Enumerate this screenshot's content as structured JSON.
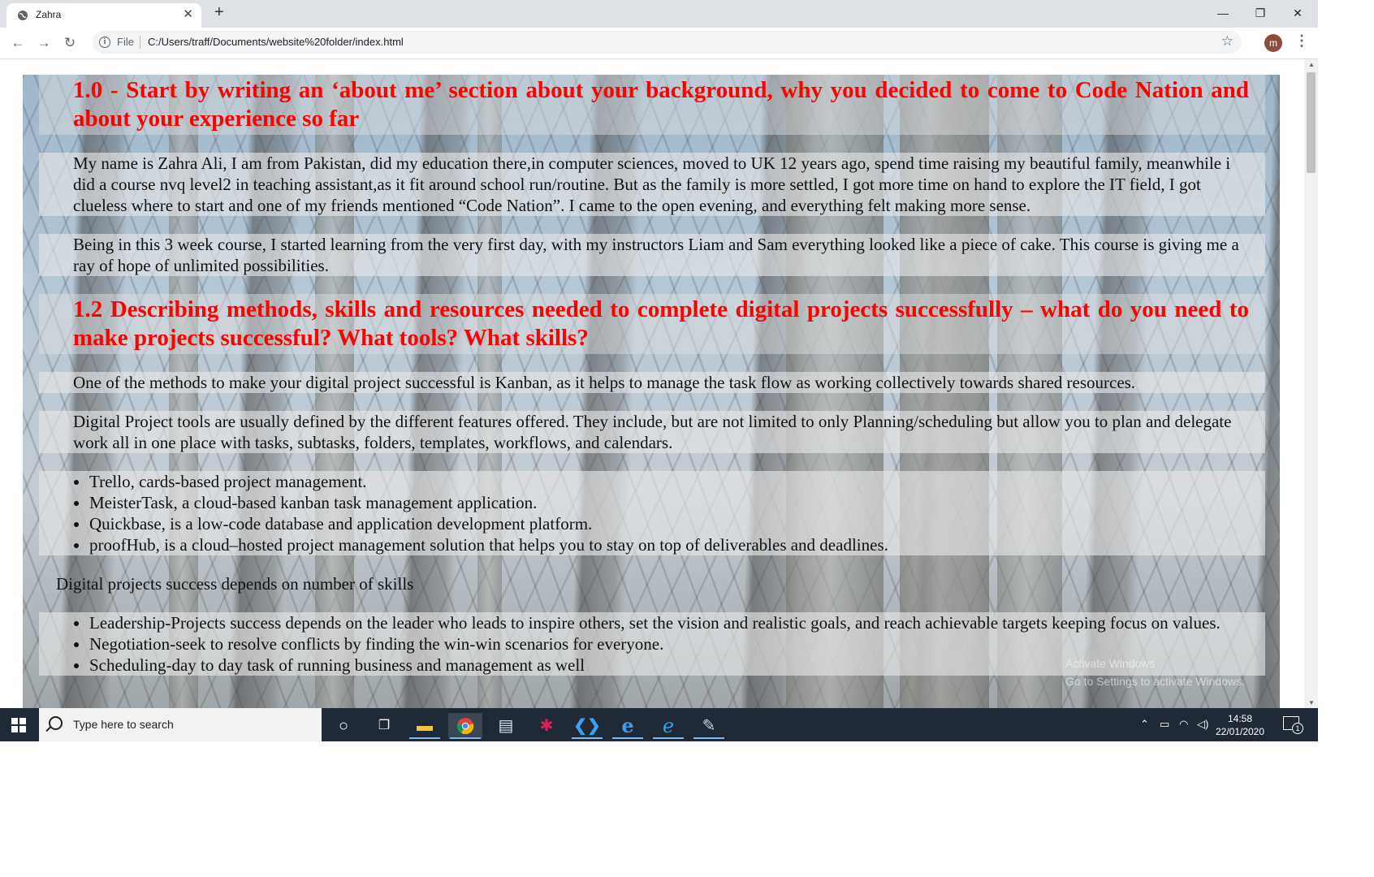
{
  "browser": {
    "tab_title": "Zahra",
    "tab_close": "✕",
    "new_tab": "+",
    "window_minimize": "—",
    "window_restore": "❐",
    "window_close": "✕",
    "scheme_label": "File",
    "url": "C:/Users/traff/Documents/website%20folder/index.html",
    "profile_initial": "m"
  },
  "page": {
    "heading1": "1.0 - Start by writing an ‘about me’ section about your background, why you decided to come to Code Nation and about your experience so far",
    "para1": "My name is Zahra Ali, I am from Pakistan, did my education there,in computer sciences, moved to UK 12 years ago, spend time raising my beautiful family, meanwhile i did a course nvq level2 in teaching assistant,as it fit around school run/routine. But as the family is more settled, I got more time on hand to explore the IT field, I got clueless where to start and one of my friends mentioned “Code Nation”. I came to the open evening, and everything felt making more sense.",
    "para2": "Being in this 3 week course, I started learning from the very first day, with my instructors Liam and Sam everything looked like a piece of cake. This course is giving me a ray of hope of unlimited possibilities.",
    "heading2": "1.2 Describing methods, skills and resources needed to complete digital projects successfully – what do you need to make projects successful? What tools? What skills?",
    "para3": "One of the methods to make your digital project successful is Kanban, as it helps to manage the task flow as working collectively towards shared resources.",
    "para4": "Digital Project tools are usually defined by the different features offered. They include, but are not limited to only Planning/scheduling but allow you to plan and delegate work all in one place with tasks, subtasks, folders, templates, workflows, and calendars.",
    "tools": [
      "Trello, cards-based project management.",
      "MeisterTask, a cloud-based kanban task management application.",
      "Quickbase, is a low-code database and application development platform.",
      "proofHub, is a cloud–hosted project management solution that helps you to stay on top of deliverables and deadlines."
    ],
    "skills_intro": "Digital projects success depends on number of skills",
    "skills": [
      "Leadership-Projects success depends on the leader who leads to inspire others, set the vision and realistic goals, and reach achievable targets keeping focus on values.",
      "Negotiation-seek to resolve conflicts by finding the win-win scenarios for everyone.",
      "Scheduling-day to day task of running business and management as well"
    ]
  },
  "watermark": {
    "line1": "Activate Windows",
    "line2": "Go to Settings to activate Windows."
  },
  "taskbar": {
    "search_placeholder": "Type here to search",
    "time": "14:58",
    "date": "22/01/2020",
    "notification_count": "1"
  },
  "icons": [
    "globe-icon",
    "back-arrow-icon",
    "forward-arrow-icon",
    "reload-icon",
    "info-icon",
    "star-icon",
    "windows-start-icon",
    "search-icon",
    "cortana-icon",
    "task-view-icon",
    "file-explorer-icon",
    "chrome-icon",
    "notepad-icon",
    "slack-icon",
    "vscode-icon",
    "edge-icon",
    "ie-icon",
    "paint-icon",
    "chevron-up-icon",
    "battery-icon",
    "wifi-icon",
    "volume-icon",
    "notification-icon"
  ]
}
